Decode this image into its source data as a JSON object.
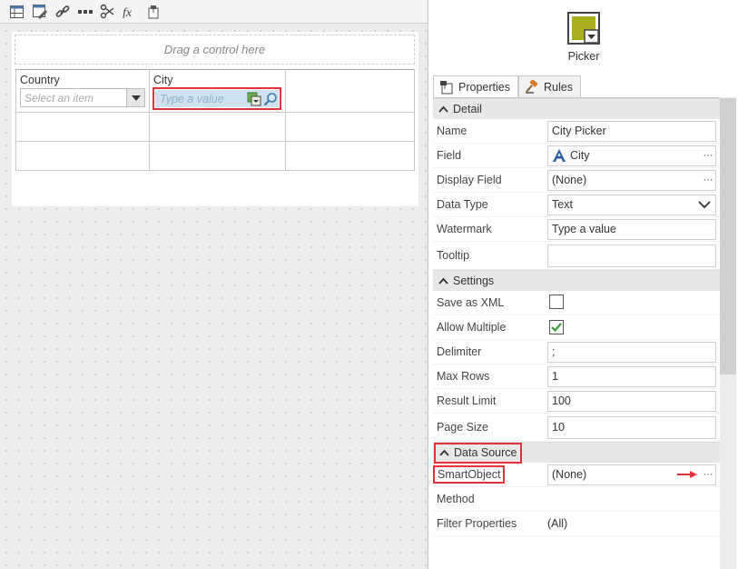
{
  "designer": {
    "toolbar_icons": [
      "table-icon",
      "edit-form-icon",
      "link-icon",
      "more-icon",
      "scissors-icon",
      "fx-icon",
      "pin-icon"
    ],
    "drag_hint": "Drag a control here",
    "columns": [
      {
        "header": "Country",
        "placeholder": "Select an item"
      },
      {
        "header": "City",
        "placeholder": "Type a value"
      }
    ]
  },
  "control": {
    "type_label": "Picker",
    "icon": "picker-icon"
  },
  "tabs": [
    {
      "label": "Properties",
      "icon": "properties-icon",
      "active": true
    },
    {
      "label": "Rules",
      "icon": "gavel-icon",
      "active": false
    }
  ],
  "sections": {
    "detail": {
      "title": "Detail",
      "rows": {
        "name": {
          "label": "Name",
          "value": "City Picker"
        },
        "field": {
          "label": "Field",
          "value": "City",
          "ellipsis": "···"
        },
        "display_field": {
          "label": "Display Field",
          "value": "(None)",
          "ellipsis": "···"
        },
        "data_type": {
          "label": "Data Type",
          "value": "Text"
        },
        "watermark": {
          "label": "Watermark",
          "value": "Type a value"
        },
        "tooltip": {
          "label": "Tooltip",
          "value": ""
        }
      }
    },
    "settings": {
      "title": "Settings",
      "rows": {
        "save_as_xml": {
          "label": "Save as XML",
          "checked": false
        },
        "allow_multiple": {
          "label": "Allow Multiple",
          "checked": true
        },
        "delimiter": {
          "label": "Delimiter",
          "value": ";"
        },
        "max_rows": {
          "label": "Max Rows",
          "value": "1"
        },
        "result_limit": {
          "label": "Result Limit",
          "value": "100"
        },
        "page_size": {
          "label": "Page Size",
          "value": "10"
        }
      }
    },
    "data_source": {
      "title": "Data Source",
      "rows": {
        "smartobject": {
          "label": "SmartObject",
          "value": "(None)",
          "ellipsis": "···"
        },
        "method": {
          "label": "Method",
          "value": ""
        },
        "filter_properties": {
          "label": "Filter Properties",
          "value": "(All)"
        }
      }
    }
  },
  "colors": {
    "highlight": "#e2333b",
    "accent": "#a8b020",
    "field_letter": "#2a5d9f"
  }
}
